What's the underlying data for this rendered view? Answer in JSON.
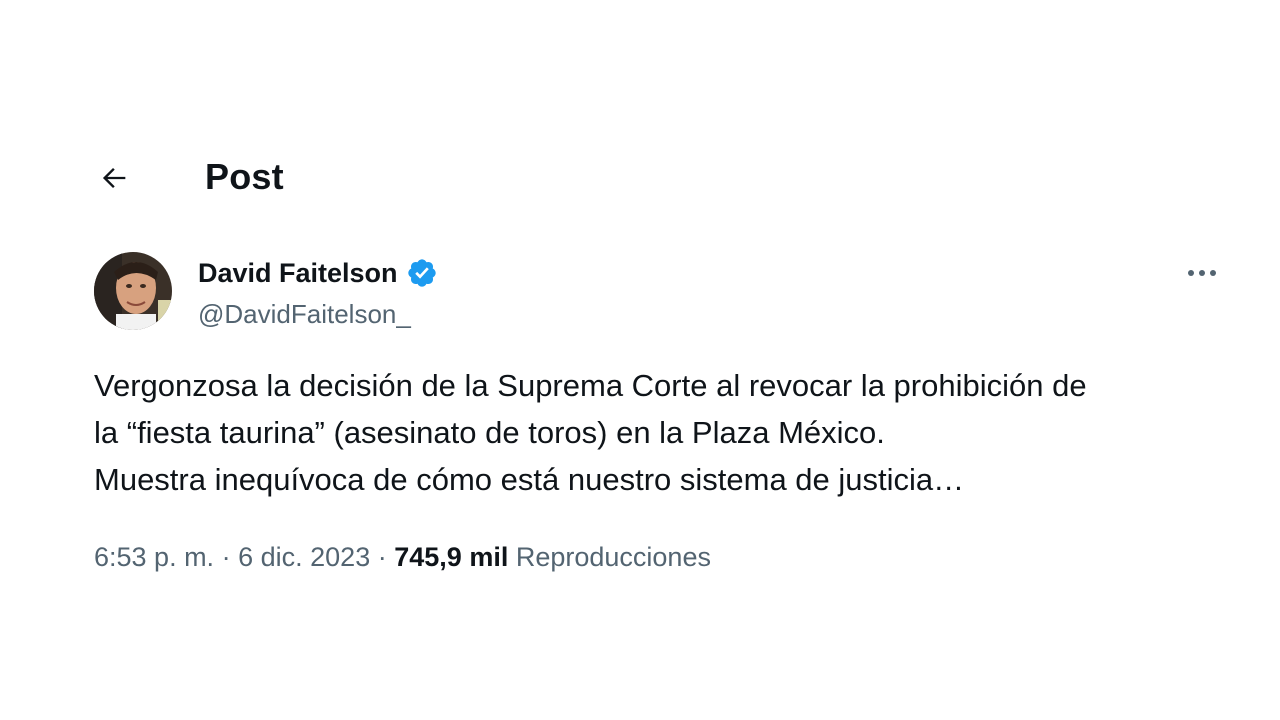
{
  "header": {
    "title": "Post",
    "back_icon": "arrow-left-icon"
  },
  "author": {
    "name": "David Faitelson",
    "handle": "@DavidFaitelson_",
    "verified_icon": "verified-badge-icon",
    "verified_color": "#1d9bf0"
  },
  "post": {
    "lines": [
      "Vergonzosa la decisión de la Suprema Corte al revocar la prohibición de",
      "la “fiesta taurina” (asesinato de toros) en la Plaza México.",
      "Muestra inequívoca de cómo está nuestro sistema de justicia…"
    ],
    "time": "6:53 p. m.",
    "separator": "·",
    "date": "6 dic. 2023",
    "views_count": "745,9 mil",
    "views_label": "Reproducciones"
  },
  "more_icon": "more-horizontal-icon",
  "colors": {
    "text": "#0f1419",
    "secondary": "#536471",
    "accent": "#1d9bf0"
  }
}
